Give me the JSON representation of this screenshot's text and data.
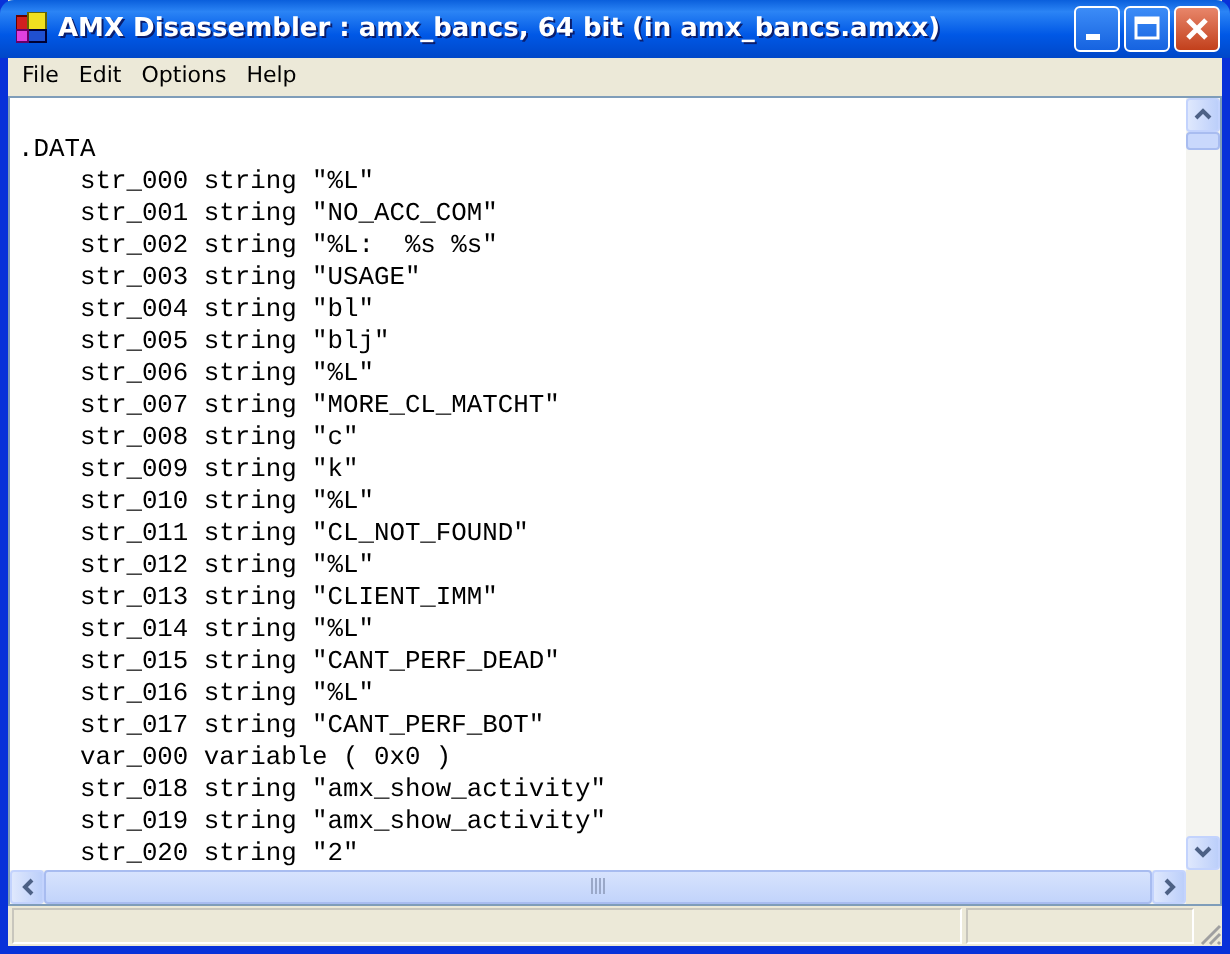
{
  "window": {
    "title": "AMX Disassembler : amx_bancs, 64 bit (in amx_bancs.amxx)"
  },
  "menu": [
    "File",
    "Edit",
    "Options",
    "Help"
  ],
  "lines": [
    {
      "kind": "section",
      "text": ".DATA"
    },
    {
      "kind": "entry",
      "text": "str_000 string \"%L\""
    },
    {
      "kind": "entry",
      "text": "str_001 string \"NO_ACC_COM\""
    },
    {
      "kind": "entry",
      "text": "str_002 string \"%L:  %s %s\""
    },
    {
      "kind": "entry",
      "text": "str_003 string \"USAGE\""
    },
    {
      "kind": "entry",
      "text": "str_004 string \"bl\""
    },
    {
      "kind": "entry",
      "text": "str_005 string \"blj\""
    },
    {
      "kind": "entry",
      "text": "str_006 string \"%L\""
    },
    {
      "kind": "entry",
      "text": "str_007 string \"MORE_CL_MATCHT\""
    },
    {
      "kind": "entry",
      "text": "str_008 string \"c\""
    },
    {
      "kind": "entry",
      "text": "str_009 string \"k\""
    },
    {
      "kind": "entry",
      "text": "str_010 string \"%L\""
    },
    {
      "kind": "entry",
      "text": "str_011 string \"CL_NOT_FOUND\""
    },
    {
      "kind": "entry",
      "text": "str_012 string \"%L\""
    },
    {
      "kind": "entry",
      "text": "str_013 string \"CLIENT_IMM\""
    },
    {
      "kind": "entry",
      "text": "str_014 string \"%L\""
    },
    {
      "kind": "entry",
      "text": "str_015 string \"CANT_PERF_DEAD\""
    },
    {
      "kind": "entry",
      "text": "str_016 string \"%L\""
    },
    {
      "kind": "entry",
      "text": "str_017 string \"CANT_PERF_BOT\""
    },
    {
      "kind": "entry",
      "text": "var_000 variable ( 0x0 )"
    },
    {
      "kind": "entry",
      "text": "str_018 string \"amx_show_activity\""
    },
    {
      "kind": "entry",
      "text": "str_019 string \"amx_show_activity\""
    },
    {
      "kind": "entry",
      "text": "str_020 string \"2\""
    }
  ]
}
